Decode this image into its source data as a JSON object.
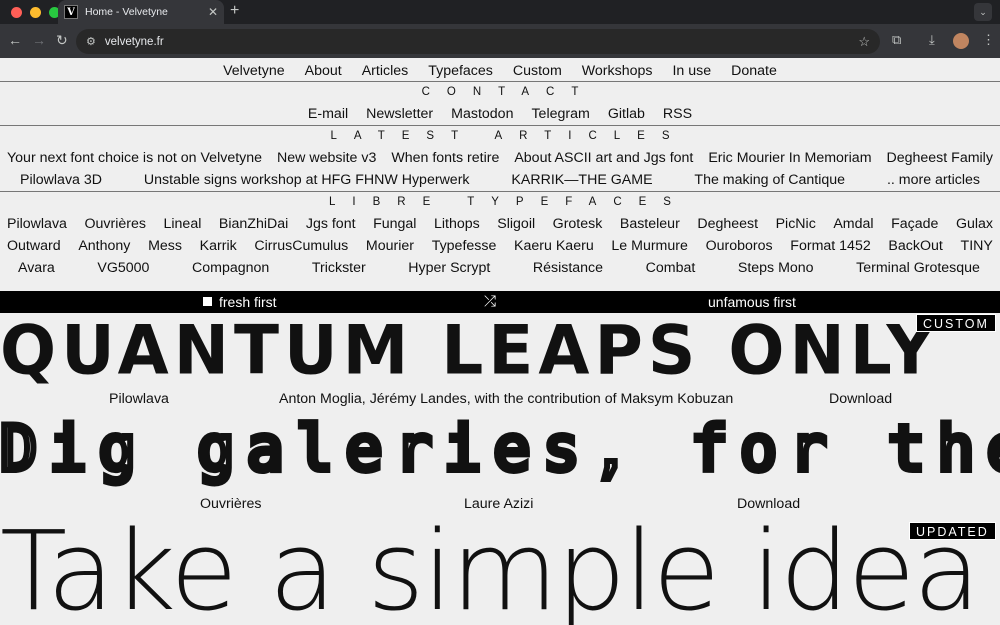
{
  "browser": {
    "tab_title": "Home - Velvetyne",
    "favicon_letter": "V",
    "url": "velvetyne.fr",
    "icons": [
      "back-icon",
      "forward-icon",
      "reload-icon",
      "site-info-icon",
      "bookmark-star-icon",
      "extensions-icon",
      "download-icon",
      "profile-avatar",
      "menu-icon"
    ]
  },
  "nav": [
    "Velvetyne",
    "About",
    "Articles",
    "Typefaces",
    "Custom",
    "Workshops",
    "In use",
    "Donate"
  ],
  "contact": {
    "heading": "CONTACT",
    "links": [
      "E-mail",
      "Newsletter",
      "Mastodon",
      "Telegram",
      "Gitlab",
      "RSS"
    ]
  },
  "articles": {
    "heading": "LATEST ARTICLES",
    "row1": [
      "Your next font choice is not on Velvetyne",
      "New website v3",
      "When fonts retire",
      "About ASCII art and Jgs font",
      "Eric Mourier In Memoriam",
      "Degheest Family"
    ],
    "row2": [
      "Pilowlava 3D",
      "Unstable signs workshop at HFG FHNW Hyperwerk",
      "KARRIK—THE GAME",
      "The making of Cantique",
      ".. more articles"
    ]
  },
  "typefaces": {
    "heading": "LIBRE TYPEFACES",
    "row1": [
      "Pilowlava",
      "Ouvrières",
      "Lineal",
      "BianZhiDai",
      "Jgs font",
      "Fungal",
      "Lithops",
      "Sligoil",
      "Grotesk",
      "Basteleur",
      "Degheest",
      "PicNic",
      "Amdal",
      "Façade",
      "Gulax"
    ],
    "row2": [
      "Outward",
      "Anthony",
      "Mess",
      "Karrik",
      "CirrusCumulus",
      "Mourier",
      "Typefesse",
      "Kaeru Kaeru",
      "Le Murmure",
      "Ouroboros",
      "Format 1452",
      "BackOut",
      "TINY"
    ],
    "row3": [
      "Avara",
      "VG5000",
      "Compagnon",
      "Trickster",
      "Hyper Scrypt",
      "Résistance",
      "Combat",
      "Steps Mono",
      "Terminal Grotesque"
    ]
  },
  "filter": {
    "fresh": "fresh first",
    "shuffle_icon": "shuffle-icon",
    "unfamous": "unfamous first"
  },
  "specimens": [
    {
      "sample": "QUANTUM LEAPS ONLY",
      "badge": "CUSTOM",
      "name": "Pilowlava",
      "authors": "Anton Moglia, Jérémy Landes, with the contribution of Maksym Kobuzan",
      "download": "Download"
    },
    {
      "sample": "Dig galeries, for the crown !",
      "name": "Ouvrières",
      "authors": "Laure Azizi",
      "download": "Download"
    },
    {
      "sample": "Take a simple idea",
      "badge": "UPDATED"
    }
  ]
}
